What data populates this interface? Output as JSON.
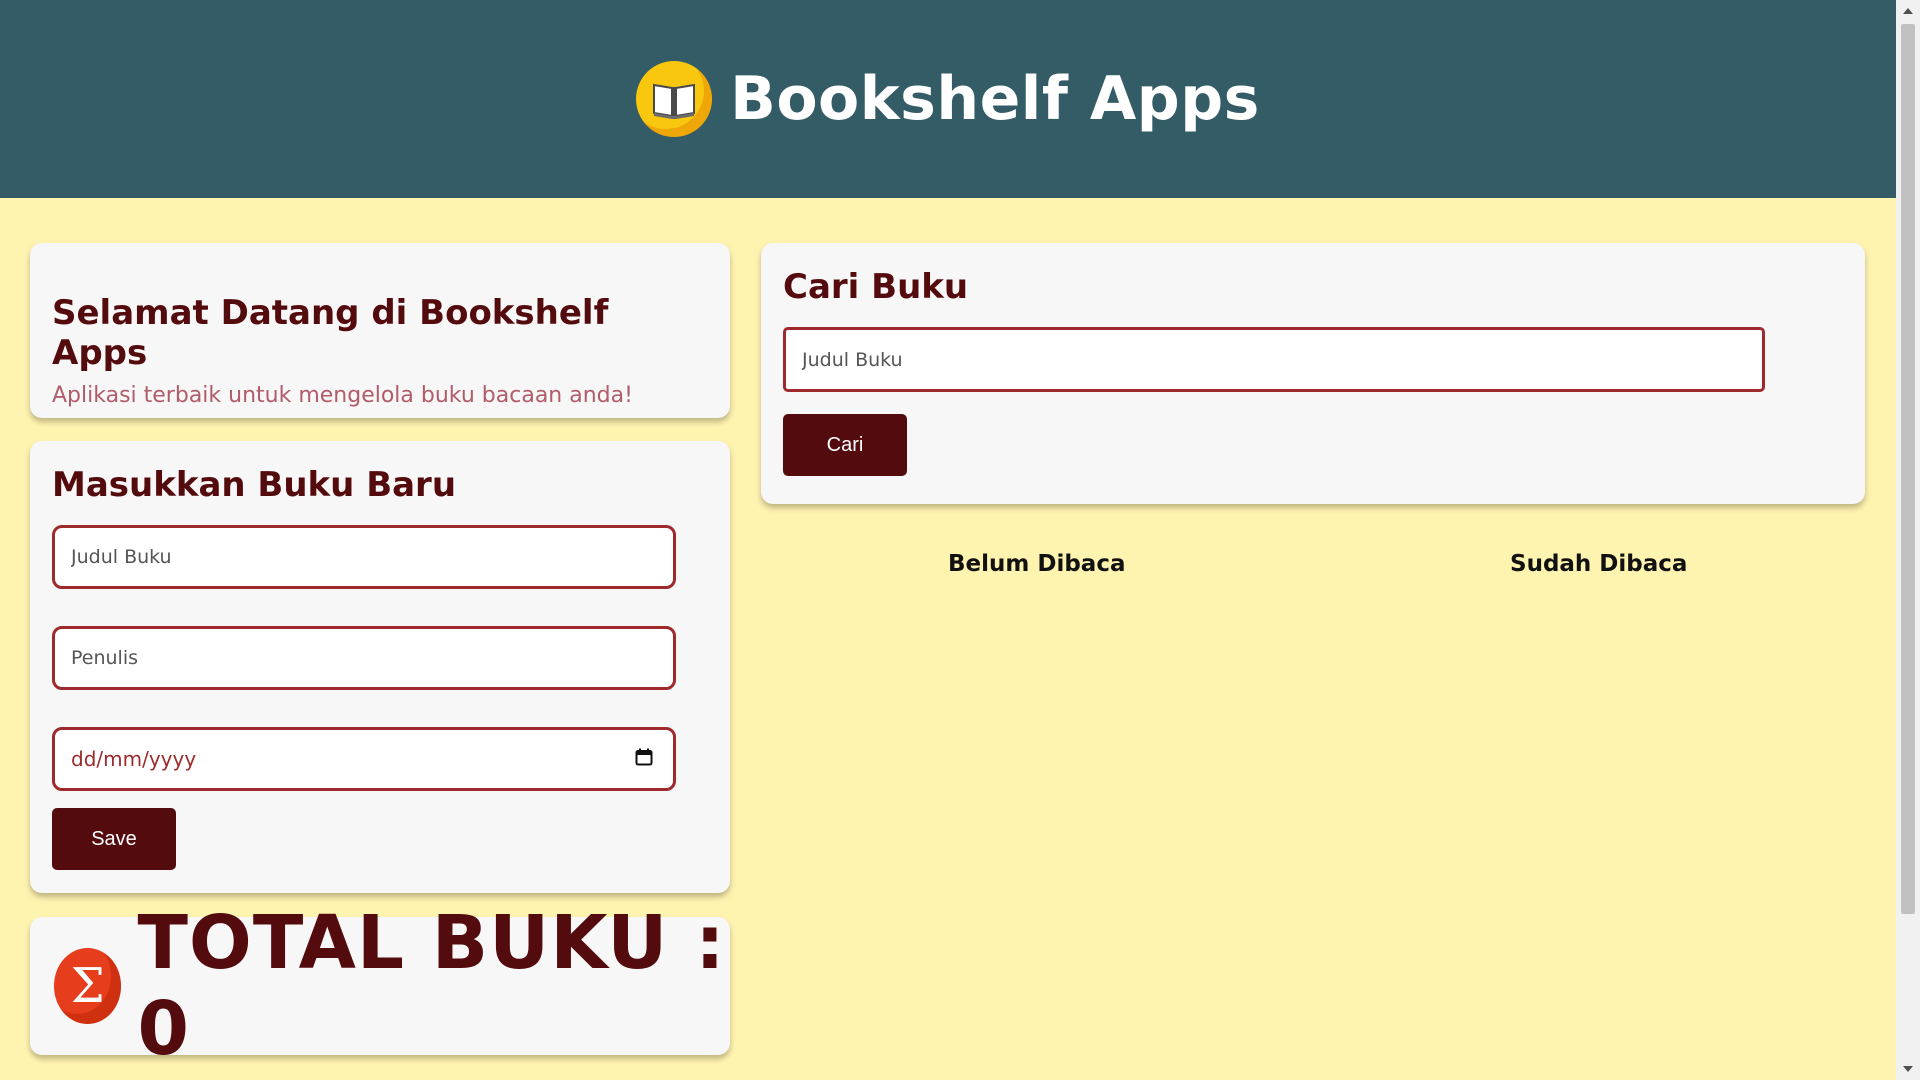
{
  "header": {
    "logo_icon": "open-book-icon",
    "title": "Bookshelf Apps"
  },
  "welcome": {
    "heading": "Selamat Datang di Bookshelf Apps",
    "subheading": "Aplikasi terbaik untuk mengelola buku bacaan anda!"
  },
  "form": {
    "heading": "Masukkan Buku Baru",
    "title_placeholder": "Judul Buku",
    "author_placeholder": "Penulis",
    "date_placeholder": "dd/mm/yyyy",
    "date_icon": "calendar-icon",
    "save_label": "Save"
  },
  "total": {
    "icon": "sigma-icon",
    "label": "TOTAL BUKU : 0"
  },
  "search": {
    "heading": "Cari Buku",
    "placeholder": "Judul Buku",
    "button_label": "Cari"
  },
  "shelves": {
    "unread_label": "Belum Dibaca",
    "read_label": "Sudah Dibaca"
  },
  "colors": {
    "header_bg": "#335c67",
    "page_bg": "#fff3b0",
    "accent_dark": "#540b0e",
    "accent_border": "#9e2a2b"
  }
}
